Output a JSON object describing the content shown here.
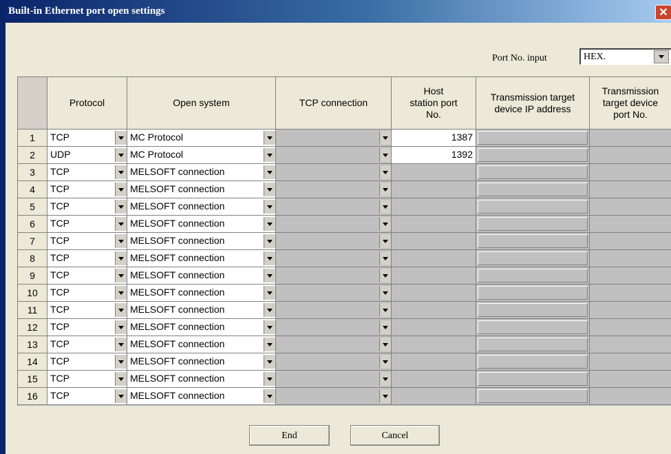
{
  "window": {
    "title": "Built-in Ethernet port open settings",
    "close": "✕"
  },
  "port_input": {
    "label": "Port No. input",
    "value": "HEX."
  },
  "table": {
    "headers": [
      "Protocol",
      "Open system",
      "TCP connection",
      "Host station port No.",
      "Transmission target device IP address",
      "Transmission target device port No."
    ],
    "rows": [
      {
        "num": "1",
        "protocol": "TCP",
        "open_system": "MC Protocol",
        "port": "1387"
      },
      {
        "num": "2",
        "protocol": "UDP",
        "open_system": "MC Protocol",
        "port": "1392"
      },
      {
        "num": "3",
        "protocol": "TCP",
        "open_system": "MELSOFT connection",
        "port": ""
      },
      {
        "num": "4",
        "protocol": "TCP",
        "open_system": "MELSOFT connection",
        "port": ""
      },
      {
        "num": "5",
        "protocol": "TCP",
        "open_system": "MELSOFT connection",
        "port": ""
      },
      {
        "num": "6",
        "protocol": "TCP",
        "open_system": "MELSOFT connection",
        "port": ""
      },
      {
        "num": "7",
        "protocol": "TCP",
        "open_system": "MELSOFT connection",
        "port": ""
      },
      {
        "num": "8",
        "protocol": "TCP",
        "open_system": "MELSOFT connection",
        "port": ""
      },
      {
        "num": "9",
        "protocol": "TCP",
        "open_system": "MELSOFT connection",
        "port": ""
      },
      {
        "num": "10",
        "protocol": "TCP",
        "open_system": "MELSOFT connection",
        "port": ""
      },
      {
        "num": "11",
        "protocol": "TCP",
        "open_system": "MELSOFT connection",
        "port": ""
      },
      {
        "num": "12",
        "protocol": "TCP",
        "open_system": "MELSOFT connection",
        "port": ""
      },
      {
        "num": "13",
        "protocol": "TCP",
        "open_system": "MELSOFT connection",
        "port": ""
      },
      {
        "num": "14",
        "protocol": "TCP",
        "open_system": "MELSOFT connection",
        "port": ""
      },
      {
        "num": "15",
        "protocol": "TCP",
        "open_system": "MELSOFT connection",
        "port": ""
      },
      {
        "num": "16",
        "protocol": "TCP",
        "open_system": "MELSOFT connection",
        "port": ""
      }
    ]
  },
  "buttons": {
    "end": "End",
    "cancel": "Cancel"
  }
}
